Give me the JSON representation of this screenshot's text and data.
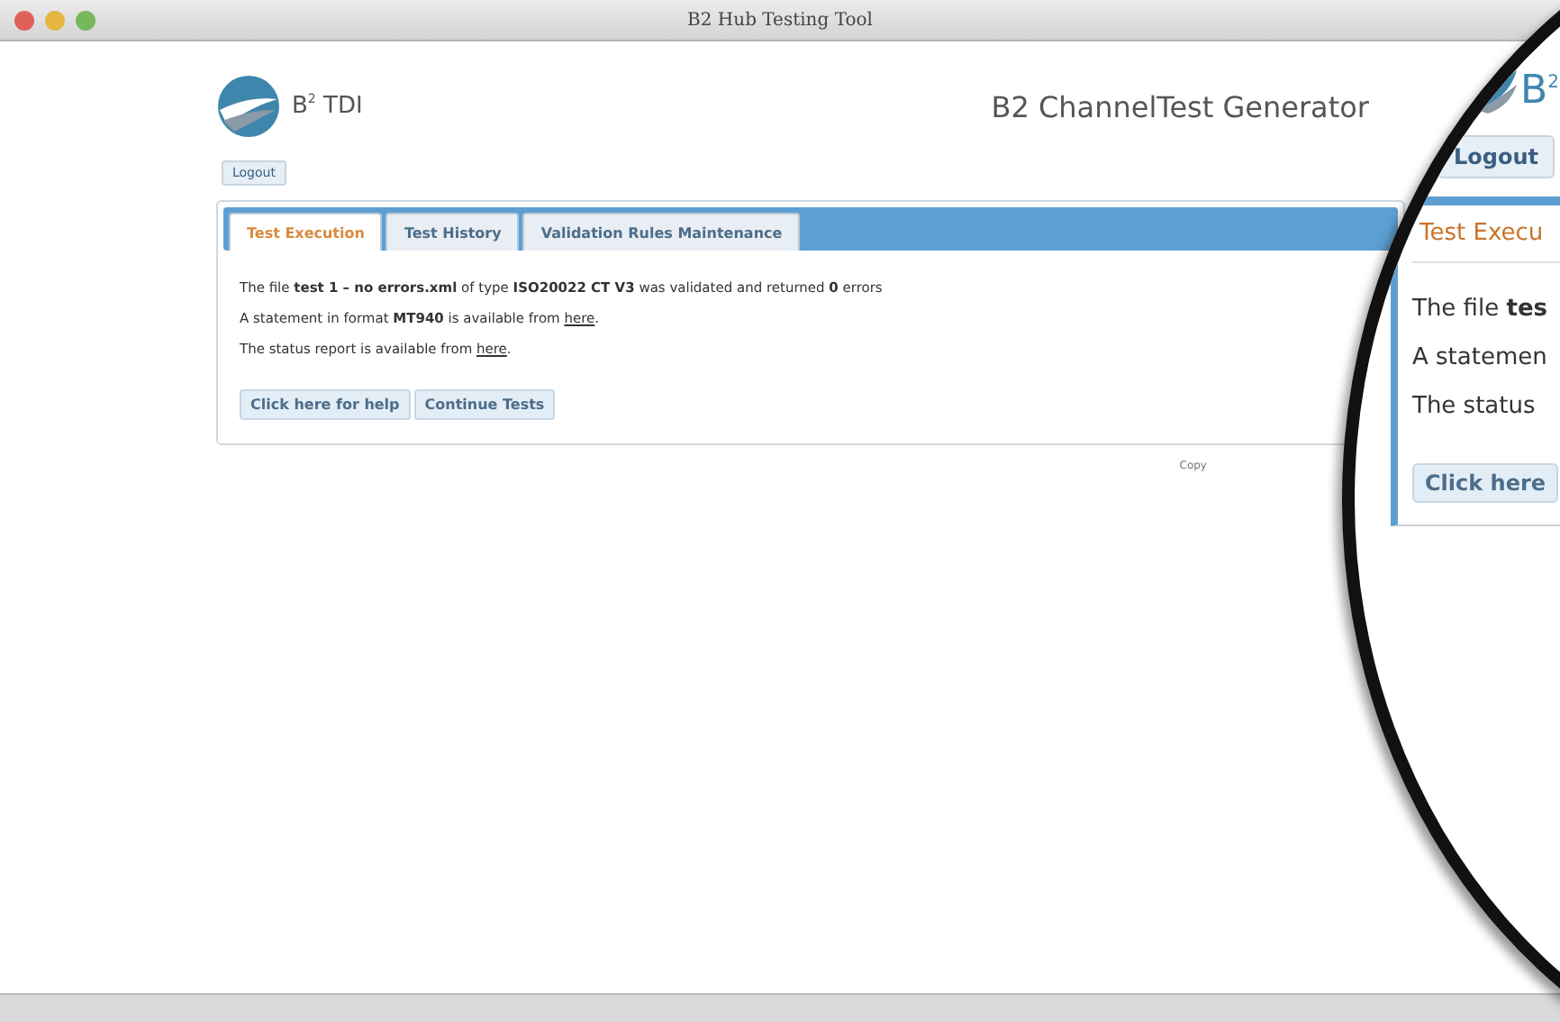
{
  "window": {
    "title": "B2 Hub Testing Tool"
  },
  "header": {
    "logo_text": "B$^{2}$ TDI",
    "app_title": "B2 ChannelTest Generator"
  },
  "logout": "Logout",
  "tabs": [
    {
      "label": "Test Execution",
      "selected": true
    },
    {
      "label": "Test History",
      "selected": false
    },
    {
      "label": "Validation Rules Maintenance",
      "selected": false
    }
  ],
  "messages": [
    {
      "text": "The file **test 1 – no errors.xml** of type **ISO20022 CT V3** was validated and returned **0** errors"
    },
    {
      "text": "A statement in format **MT940** is available from ",
      "link": "here",
      "after": "."
    },
    {
      "text": "The status report is available from ",
      "link": "here",
      "after": "."
    }
  ],
  "buttons": [
    "Click here for help",
    "Continue Tests"
  ],
  "footer": "Copy",
  "magnifier": {
    "logo_text": "B$^{2}$",
    "logout": "Logout",
    "tab": "Test Execu",
    "lines": [
      "The file **tes**",
      "A statemen",
      "The status"
    ],
    "button": "Click here"
  }
}
